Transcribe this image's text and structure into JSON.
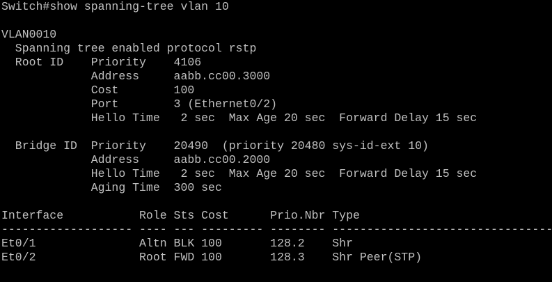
{
  "terminal": {
    "prompt": "Switch#",
    "command": "show spanning-tree vlan 10",
    "text_color": "#c0c0c0",
    "background_color": "#000000"
  },
  "output": {
    "lines": [
      "VLAN0010",
      "  Spanning tree enabled protocol rstp",
      "  Root ID    Priority    4106",
      "             Address     aabb.cc00.3000",
      "             Cost        100",
      "             Port        3 (Ethernet0/2)",
      "             Hello Time   2 sec  Max Age 20 sec  Forward Delay 15 sec",
      "",
      "  Bridge ID  Priority    20490  (priority 20480 sys-id-ext 10)",
      "             Address     aabb.cc00.2000",
      "             Hello Time   2 sec  Max Age 20 sec  Forward Delay 15 sec",
      "             Aging Time  300 sec",
      "",
      "Interface           Role Sts Cost      Prio.Nbr Type",
      "------------------- ---- --- --------- -------- --------------------------------",
      "Et0/1               Altn BLK 100       128.2    Shr",
      "Et0/2               Root FWD 100       128.3    Shr Peer(STP)"
    ]
  }
}
